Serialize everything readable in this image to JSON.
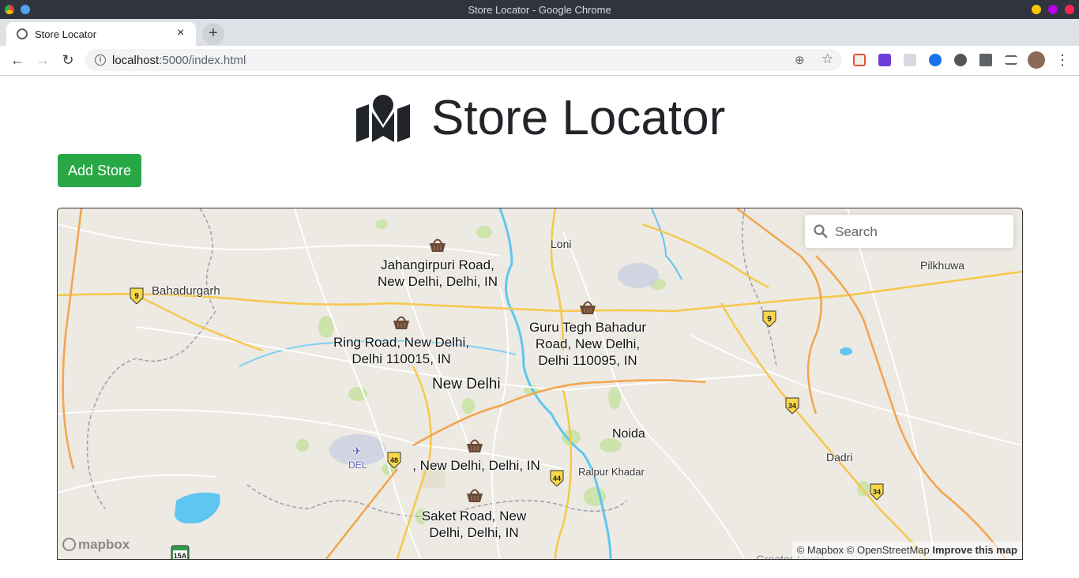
{
  "window": {
    "title": "Store Locator - Google Chrome"
  },
  "tab": {
    "label": "Store Locator",
    "close": "×",
    "new_tab": "+"
  },
  "toolbar": {
    "url_host": "localhost",
    "url_path": ":5000/index.html",
    "back": "←",
    "forward": "→",
    "reload": "↻",
    "info": "i",
    "zoom": "⊕",
    "star": "☆",
    "menu": "⋮"
  },
  "page": {
    "title": "Store Locator",
    "add_store": "Add Store"
  },
  "search": {
    "placeholder": "Search"
  },
  "map": {
    "stores": [
      {
        "line1": "Jahangirpuri Road,",
        "line2": "New Delhi, Delhi, IN"
      },
      {
        "line1": "Ring Road, New Delhi,",
        "line2": "Delhi 110015, IN"
      },
      {
        "line1": "Guru Tegh Bahadur",
        "line2": "Road, New Delhi,",
        "line3": "Delhi 110095, IN"
      },
      {
        "line1": ", New Delhi, Delhi, IN"
      },
      {
        "line1": "Saket Road, New",
        "line2": "Delhi, Delhi, IN"
      }
    ],
    "places": {
      "loni": "Loni",
      "bahadurgarh": "Bahadurgarh",
      "pilkhuwa": "Pilkhuwa",
      "new_delhi": "New Delhi",
      "noida": "Noida",
      "dadri": "Dadri",
      "ralpur_khadar": "Ralpur Khadar",
      "del": "DEL",
      "greater_noida": "Greater Noida"
    },
    "shields": [
      "9",
      "9",
      "34",
      "34",
      "48",
      "44",
      "15A"
    ],
    "attribution": {
      "mapbox": "© Mapbox",
      "osm": "© OpenStreetMap",
      "improve": "Improve this map"
    },
    "logo": "mapbox"
  },
  "colors": {
    "add_button": "#28a745",
    "title_text": "#212529",
    "map_land": "#ede9e3",
    "river": "#5ec6f0",
    "major_road": "#f5c84b",
    "store_pin": "#6b4a36"
  }
}
